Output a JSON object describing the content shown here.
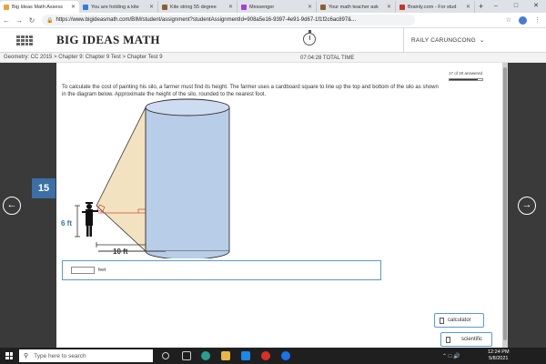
{
  "browser": {
    "tabs": [
      {
        "label": "Big Ideas Math:Assess",
        "active": true,
        "color": "#e8a33d"
      },
      {
        "label": "You are holding a kite",
        "active": false,
        "color": "#3a7bd5"
      },
      {
        "label": "Kite string 55 degree",
        "active": false,
        "color": "#8b5e34"
      },
      {
        "label": "Messenger",
        "active": false,
        "color": "#a23fd6"
      },
      {
        "label": "Your math teacher ask",
        "active": false,
        "color": "#8b5e34"
      },
      {
        "label": "Brainly.com - For stud",
        "active": false,
        "color": "#c0392b"
      }
    ],
    "url": "https://www.bigideasmath.com/BIM/student/assignment?studentAssignmentId=908a5e16-9397-4e91-9d67-1f1f2c6ac897&..."
  },
  "site": {
    "brand": "BIG IDEAS MATH",
    "user": "RAILY CARUNGCONG",
    "breadcrumb": "Geometry: CC 2015 > Chapter 9: Chapter 9 Test > Chapter Test 9",
    "total_time": "07:04:28 TOTAL TIME"
  },
  "question": {
    "number": "15",
    "progress_text": "17 of 20 answered",
    "progress_fraction": 0.85,
    "text": "To calculate the cost of painting his silo, a farmer must find its height. The farmer uses a cardboard square to line up the top and bottom of the silo as shown in the diagram below. Approximate the height of the silo, rounded to the nearest foot.",
    "diagram": {
      "person_height_label": "6 ft",
      "distance_label": "10 ft"
    },
    "answer_value": "",
    "answer_unit": "feet"
  },
  "tools": {
    "calculator": "calculator",
    "scientific": "scientific"
  },
  "taskbar": {
    "search_placeholder": "Type here to search",
    "time": "12:24 PM",
    "date": "5/8/2021"
  },
  "colors": {
    "accent_blue": "#3b6fa5",
    "silo_fill": "#b8cde8",
    "triangle_fill": "#f3e2c0"
  }
}
